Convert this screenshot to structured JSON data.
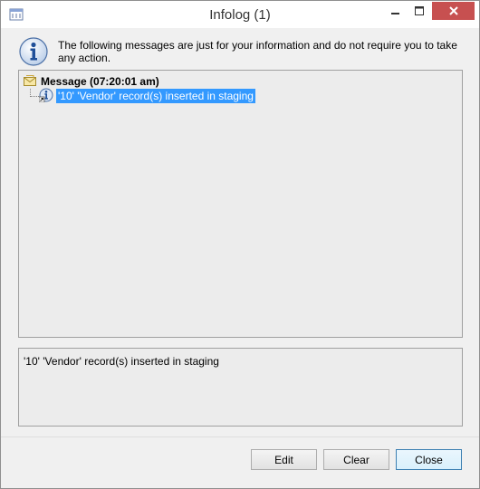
{
  "window": {
    "title": "Infolog (1)",
    "close_color": "#c75050"
  },
  "header": {
    "message": "The following messages are just for your information and do not require you to take any action."
  },
  "tree": {
    "root_label": "Message (07:20:01 am)",
    "items": [
      {
        "label": "'10' 'Vendor' record(s) inserted in staging",
        "selected": true
      }
    ],
    "selection_color": "#3399ff"
  },
  "detail": {
    "text": "'10' 'Vendor' record(s) inserted in staging"
  },
  "buttons": {
    "edit": "Edit",
    "clear": "Clear",
    "close": "Close"
  }
}
